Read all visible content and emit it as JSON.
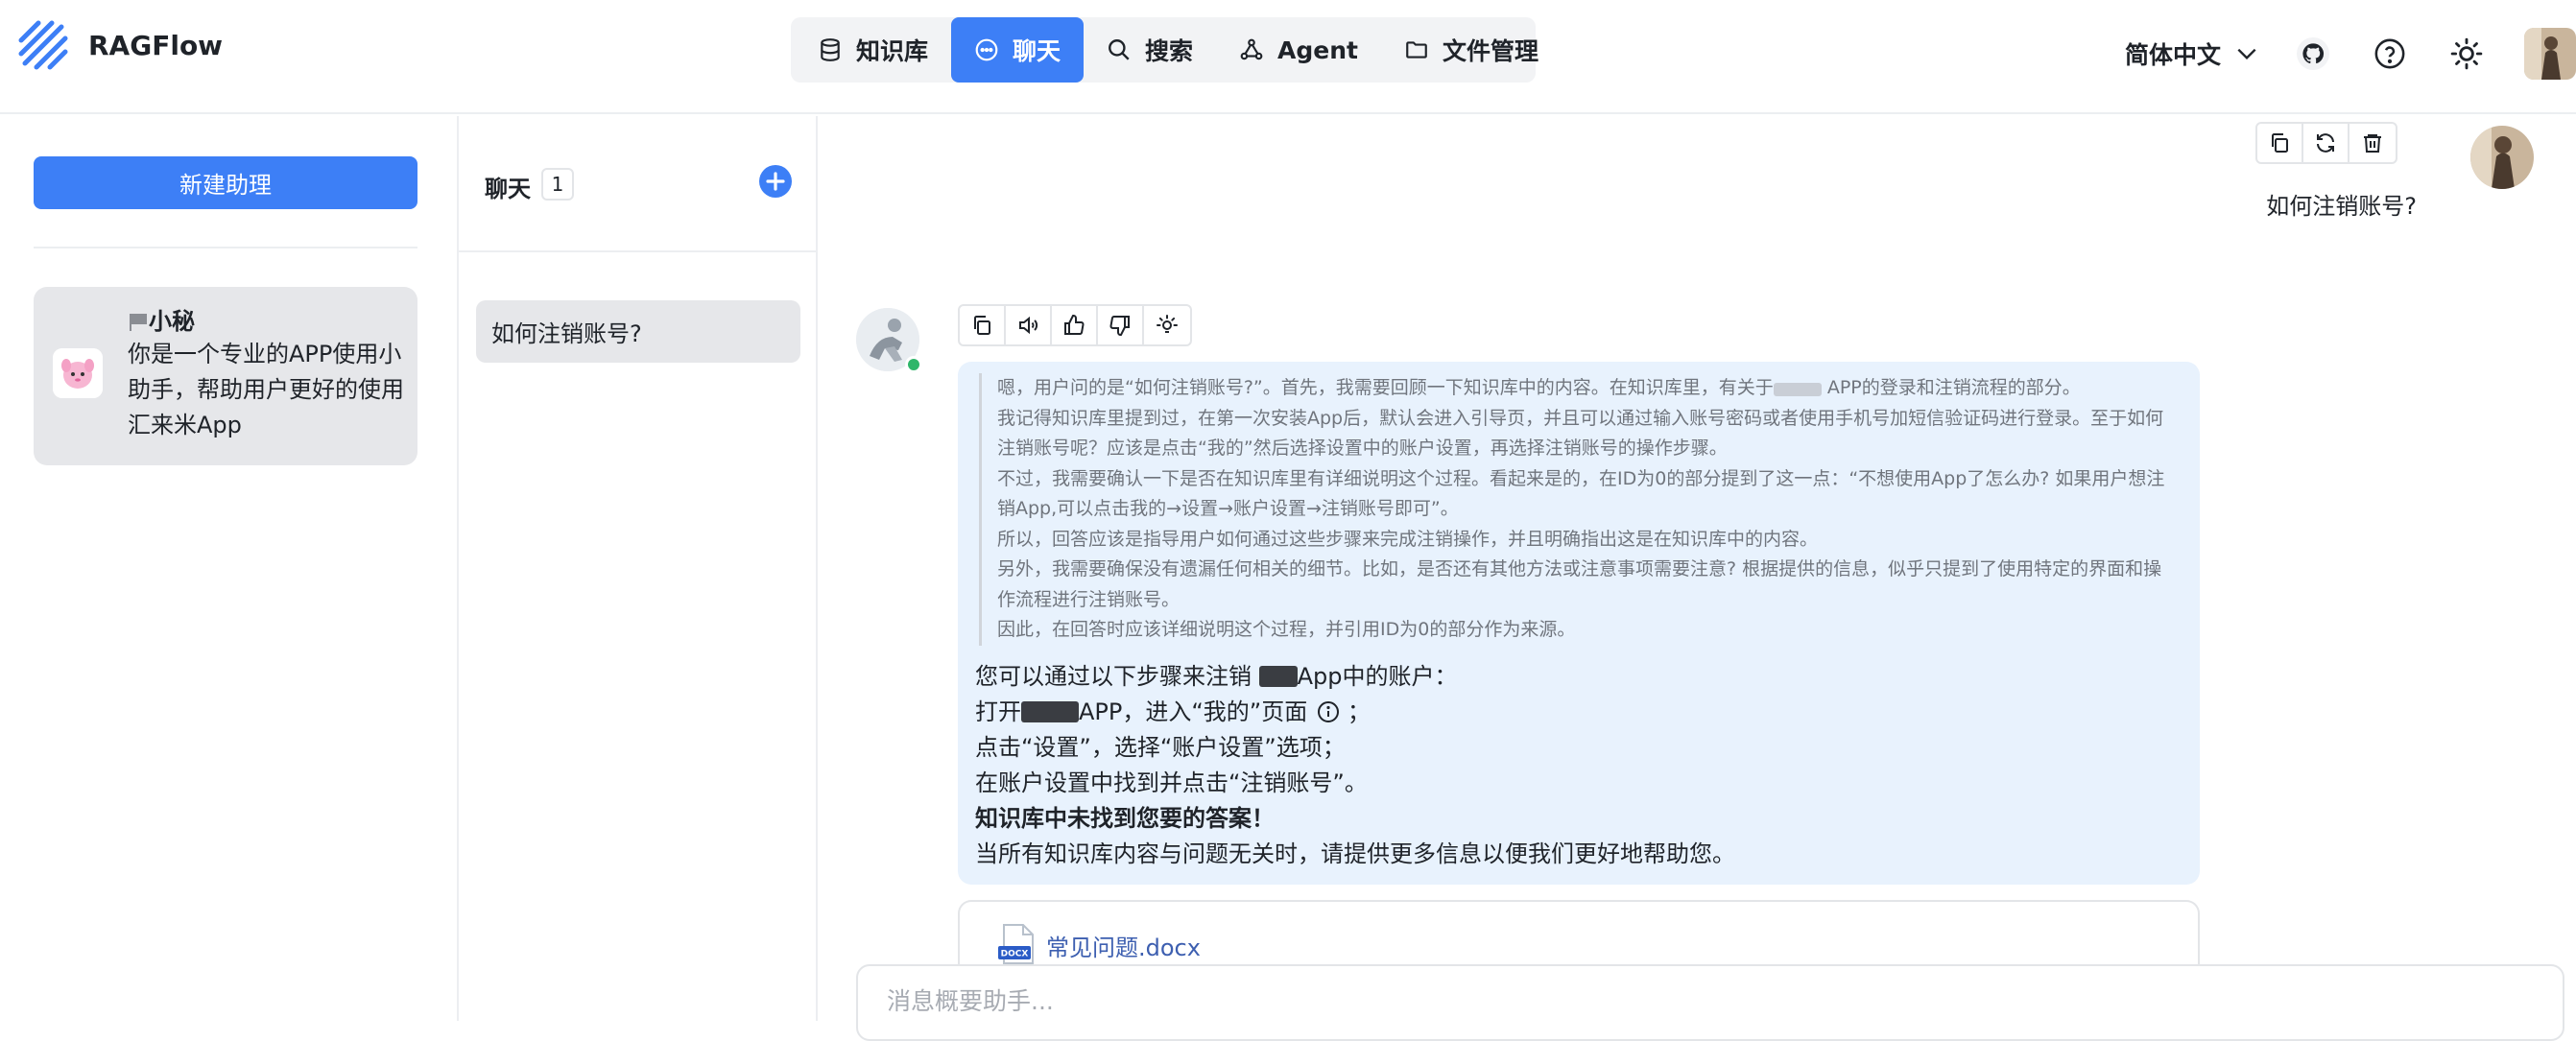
{
  "brand": {
    "name": "RAGFlow",
    "logo_icon": "ragflow-logo-icon"
  },
  "nav": [
    {
      "label": "知识库",
      "icon": "database-icon",
      "active": false
    },
    {
      "label": "聊天",
      "icon": "chat-bubble-icon",
      "active": true
    },
    {
      "label": "搜索",
      "icon": "search-icon",
      "active": false
    },
    {
      "label": "Agent",
      "icon": "agent-graph-icon",
      "active": false
    },
    {
      "label": "文件管理",
      "icon": "folder-icon",
      "active": false
    }
  ],
  "header": {
    "language": "简体中文"
  },
  "assistants": {
    "new_button": "新建助理",
    "card": {
      "name": "小秘",
      "description": "你是一个专业的APP使用小助手，帮助用户更好的使用汇来米App"
    }
  },
  "conversations": {
    "title": "聊天",
    "count": "1",
    "items": [
      {
        "label": "如何注销账号?"
      }
    ]
  },
  "chat": {
    "user_message": "如何注销账号?",
    "thinking": [
      "嗯，用户问的是“如何注销账号?”。首先，我需要回顾一下知识库中的内容。在知识库里，有关于",
      "APP的登录和注销流程的部分。",
      "我记得知识库里提到过，在第一次安装App后，默认会进入引导页，并且可以通过输入账号密码或者使用手机号加短信验证码进行登录。至于如何注销账号呢？应该是点击“我的”然后选择设置中的账户设置，再选择注销账号的操作步骤。",
      "不过，我需要确认一下是否在知识库里有详细说明这个过程。看起来是的，在ID为0的部分提到了这一点：“不想使用App了怎么办? 如果用户想注销App,可以点击我的→设置→账户设置→注销账号即可”。",
      "所以，回答应该是指导用户如何通过这些步骤来完成注销操作，并且明确指出这是在知识库中的内容。",
      "另外，我需要确保没有遗漏任何相关的细节。比如，是否还有其他方法或注意事项需要注意? 根据提供的信息，似乎只提到了使用特定的界面和操作流程进行注销账号。",
      "因此，在回答时应该详细说明这个过程，并引用ID为0的部分作为来源。"
    ],
    "answer": {
      "line1_prefix": "您可以通过以下步骤来注销",
      "line1_suffix": "App中的账户：",
      "line2_prefix": "打开",
      "line2_suffix": "APP，进入“我的”页面",
      "line2_end": "；",
      "line3": "点击“设置”，选择“账户设置”选项；",
      "line4": "在账户设置中找到并点击“注销账号”。",
      "line5": "知识库中未找到您要的答案！",
      "line6": "当所有知识库内容与问题无关时，请提供更多信息以便我们更好地帮助您。"
    },
    "reference_file": {
      "name": "常见问题.docx",
      "type_label": "DOCX"
    },
    "input_placeholder": "消息概要助手..."
  },
  "colors": {
    "accent": "#3d7ff6",
    "bubble": "#e8f2fd",
    "online": "#2fb66a"
  }
}
